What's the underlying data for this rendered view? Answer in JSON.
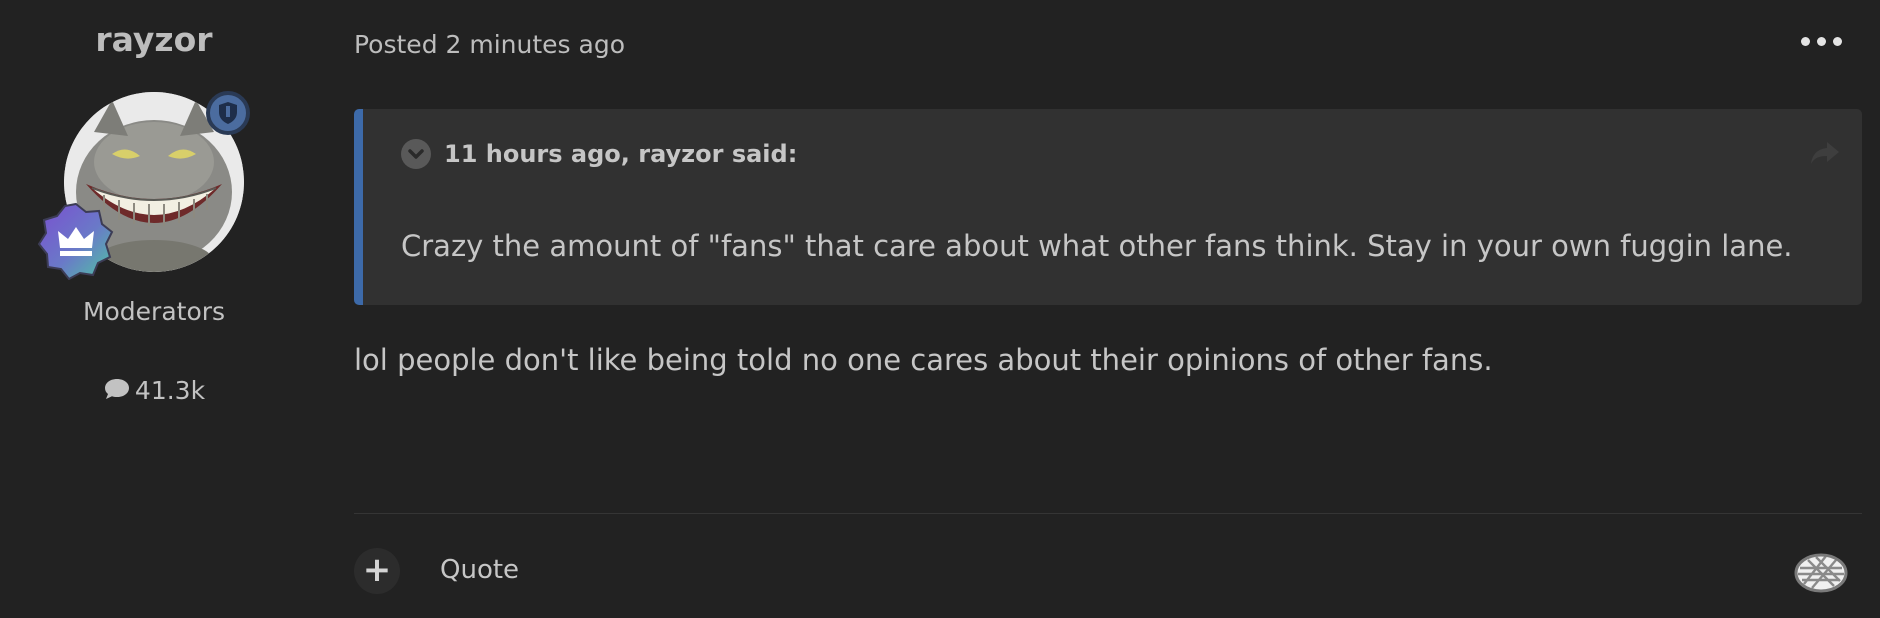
{
  "author": {
    "username": "rayzor",
    "group": "Moderators",
    "post_count": "41.3k",
    "avatar_icon": "grinning-cat-avatar",
    "moderator_badge_icon": "shield-icon",
    "rank_badge_icon": "crown-icon"
  },
  "post": {
    "meta_prefix": "Posted",
    "meta_time": "2 minutes ago",
    "more_icon": "ellipsis-icon",
    "quote": {
      "citation": "11 hours ago, rayzor said:",
      "text": "Crazy the amount of \"fans\" that care about what other fans think. Stay in your own fuggin lane.",
      "accent_color": "#3d6aa9"
    },
    "body": "lol people don't like being told no one cares about their opinions of other fans."
  },
  "footer": {
    "react_label": "+",
    "quote_label": "Quote",
    "reaction_icon": "pie-reaction-icon"
  }
}
